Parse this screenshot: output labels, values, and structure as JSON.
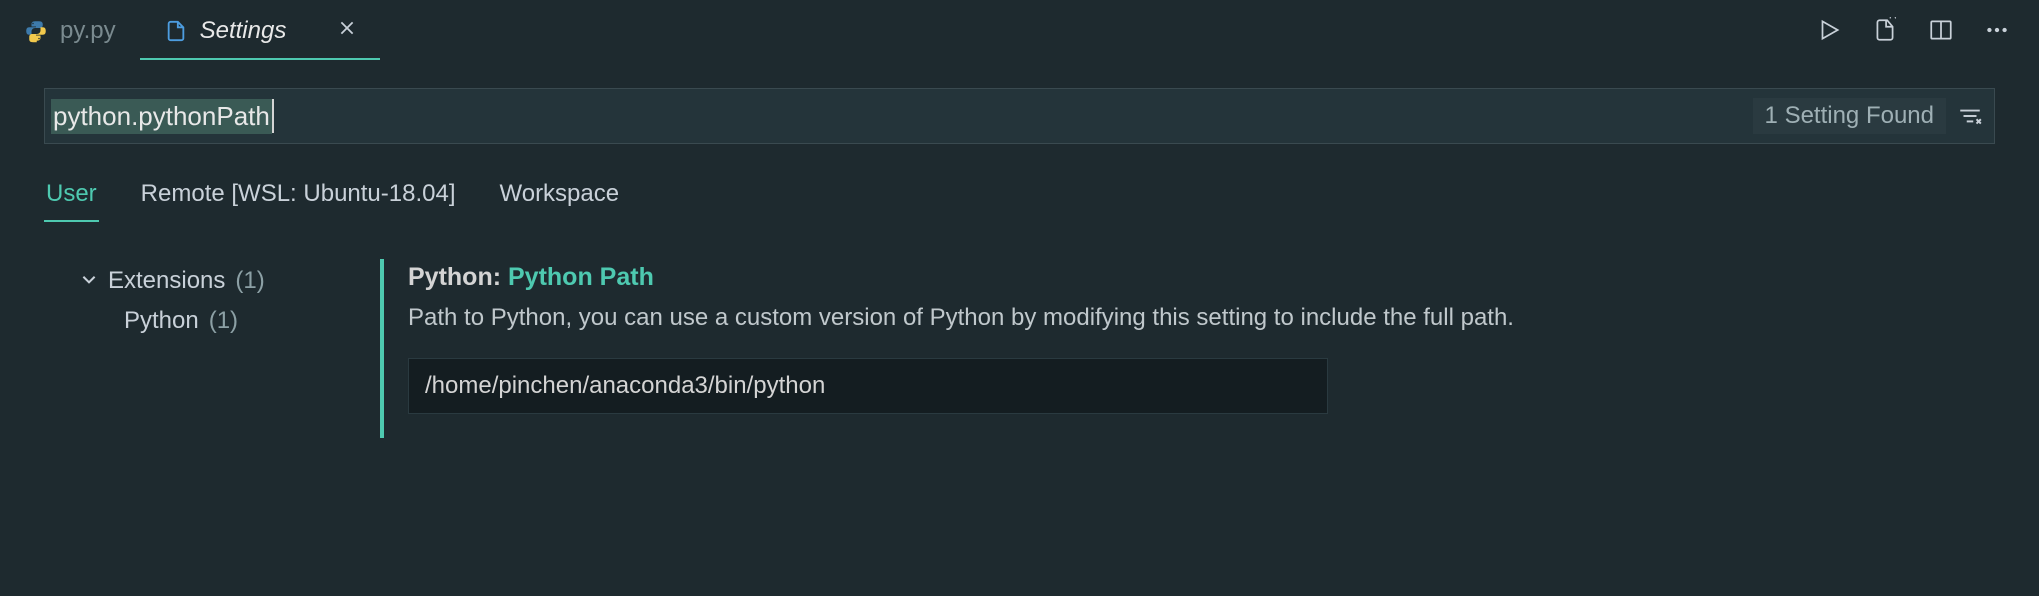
{
  "tabs": {
    "inactive": {
      "label": "py.py"
    },
    "active": {
      "label": "Settings"
    }
  },
  "search": {
    "value": "python.pythonPath",
    "count_label": "1 Setting Found"
  },
  "scope": {
    "user": "User",
    "remote": "Remote [WSL: Ubuntu-18.04]",
    "workspace": "Workspace"
  },
  "tree": {
    "group_label": "Extensions",
    "group_count": "(1)",
    "item_label": "Python",
    "item_count": "(1)"
  },
  "setting": {
    "title_prefix": "Python: ",
    "title_hl": "Python Path",
    "description": "Path to Python, you can use a custom version of Python by modifying this setting to include the full path.",
    "value": "/home/pinchen/anaconda3/bin/python"
  }
}
